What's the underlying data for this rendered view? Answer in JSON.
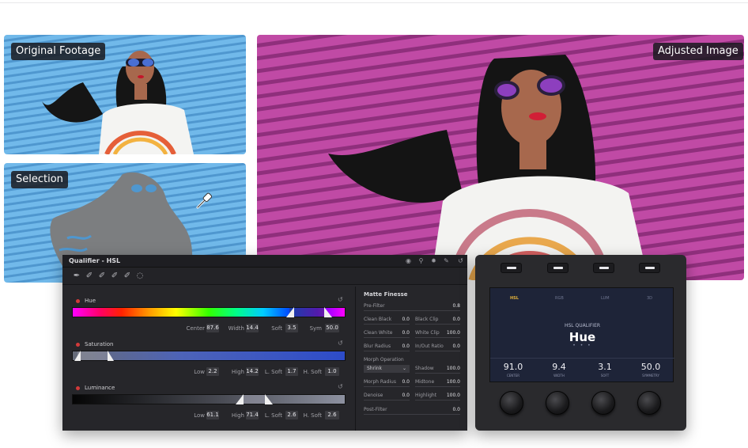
{
  "photos": {
    "original_label": "Original Footage",
    "selection_label": "Selection",
    "adjusted_label": "Adjusted Image"
  },
  "panel": {
    "title": "Qualifier - HSL",
    "hue": {
      "label": "Hue",
      "fields": [
        {
          "label": "Center",
          "value": "87.6"
        },
        {
          "label": "Width",
          "value": "14.4"
        },
        {
          "label": "Soft",
          "value": "3.5"
        },
        {
          "label": "Sym",
          "value": "50.0"
        }
      ]
    },
    "saturation": {
      "label": "Saturation",
      "fields": [
        {
          "label": "Low",
          "value": "2.2"
        },
        {
          "label": "High",
          "value": "14.2"
        },
        {
          "label": "L. Soft",
          "value": "1.7"
        },
        {
          "label": "H. Soft",
          "value": "1.0"
        }
      ]
    },
    "luminance": {
      "label": "Luminance",
      "fields": [
        {
          "label": "Low",
          "value": "61.1"
        },
        {
          "label": "High",
          "value": "71.4"
        },
        {
          "label": "L. Soft",
          "value": "2.6"
        },
        {
          "label": "H. Soft",
          "value": "2.6"
        }
      ]
    },
    "matte": {
      "title": "Matte Finesse",
      "pre_filter": {
        "label": "Pre-Filter",
        "value": "0.8"
      },
      "rows": [
        [
          {
            "label": "Clean Black",
            "value": "0.0"
          },
          {
            "label": "Black Clip",
            "value": "0.0"
          }
        ],
        [
          {
            "label": "Clean White",
            "value": "0.0"
          },
          {
            "label": "White Clip",
            "value": "100.0"
          }
        ],
        [
          {
            "label": "Blur Radius",
            "value": "0.0"
          },
          {
            "label": "In/Out Ratio",
            "value": "0.0"
          }
        ]
      ],
      "morph_op_label": "Morph Operation",
      "morph_op_value": "Shrink",
      "shadow": {
        "label": "Shadow",
        "value": "100.0"
      },
      "rows2": [
        [
          {
            "label": "Morph Radius",
            "value": "0.0"
          },
          {
            "label": "Midtone",
            "value": "100.0"
          }
        ],
        [
          {
            "label": "Denoise",
            "value": "0.0"
          },
          {
            "label": "Highlight",
            "value": "100.0"
          }
        ]
      ],
      "post_filter": {
        "label": "Post-Filter",
        "value": "0.0"
      }
    }
  },
  "device": {
    "tabs": [
      "HSL",
      "RGB",
      "LUM",
      "3D"
    ],
    "active_tab": "HSL",
    "screen_title": "HSL QUALIFIER",
    "screen_main": "Hue",
    "dots": "• • •",
    "values": [
      {
        "value": "91.0",
        "label": "CENTER"
      },
      {
        "value": "9.4",
        "label": "WIDTH"
      },
      {
        "value": "3.1",
        "label": "SOFT"
      },
      {
        "value": "50.0",
        "label": "SYMMETRY"
      }
    ]
  },
  "colors": {
    "blue_wall": "#6ab3e6",
    "magenta_wall": "#b8409c",
    "selection_gray": "#7c7e80",
    "panel_bg": "#26262a",
    "device_screen": "#1e2438",
    "accent_yellow": "#e4b23b"
  }
}
